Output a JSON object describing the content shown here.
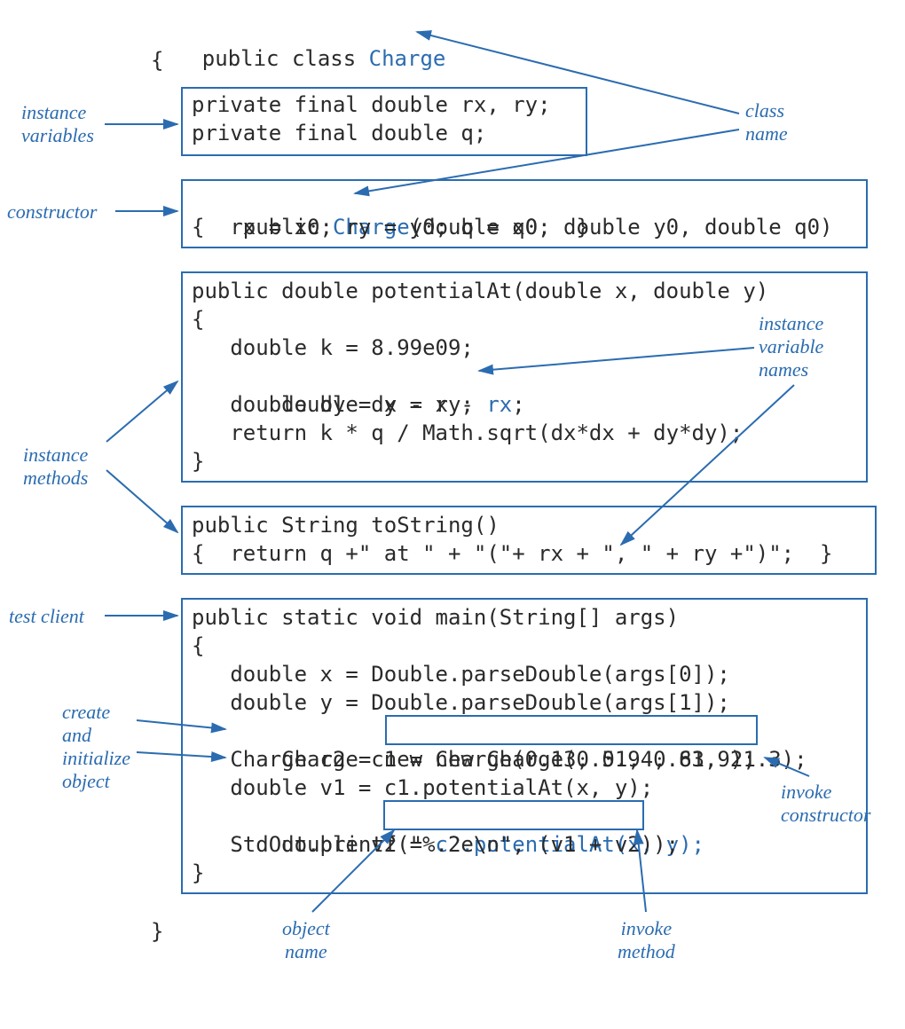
{
  "classDecl": {
    "prefix": "public class ",
    "name": "Charge"
  },
  "brace_open": "{",
  "brace_close": "}",
  "instanceVars": {
    "line1": "private final double rx, ry;",
    "line2": "private final double q;"
  },
  "constructor": {
    "sig_prefix": "public ",
    "sig_name": "Charge",
    "sig_params": "(double x0, double y0, double q0)",
    "body": "{  rx = x0; ry = y0; q = q0;  }"
  },
  "potentialAt": {
    "sig": "public double potentialAt(double x, double y)",
    "b1": "{",
    "l1": "   double k = 8.99e09;",
    "l2a": "   double dx = x - ",
    "l2b": "rx",
    "l2c": ";",
    "l3": "   double dy = y - ry;",
    "l4": "   return k * q / Math.sqrt(dx*dx + dy*dy);",
    "b2": "}"
  },
  "toString": {
    "sig": "public String toString()",
    "body": "{  return q +\" at \" + \"(\"+ rx + \", \" + ry +\")\";  }"
  },
  "main": {
    "sig": "public static void main(String[] args)",
    "b1": "{",
    "l1": "   double x = Double.parseDouble(args[0]);",
    "l2": "   double y = Double.parseDouble(args[1]);",
    "l3_pre": "   Charge c1 = ",
    "l3_box": "new Charge(0.51, 0.63, 21.3);",
    "l4": "   Charge c2 = new Charge(0.13, 0.94, 81.9);",
    "l5": "   double v1 = c1.potentialAt(x, y);",
    "l6_pre": "   double v2 = ",
    "l6_box": "c2.potentialAt(x, y);",
    "l7": "   StdOut.printf(\"%.2e\\n\", (v1 + v2));",
    "b2": "}"
  },
  "labels": {
    "instance_variables": "instance\nvariables",
    "constructor": "constructor",
    "instance_methods": "instance\nmethods",
    "test_client": "test client",
    "create_init": "create\nand\ninitialize\nobject",
    "class_name": "class\nname",
    "ivar_names": "instance\nvariable\nnames",
    "object_name": "object\nname",
    "invoke_ctor": "invoke\nconstructor",
    "invoke_method": "invoke\nmethod"
  },
  "colors": {
    "blue": "#2b6cb0",
    "text": "#2a2a2a"
  }
}
